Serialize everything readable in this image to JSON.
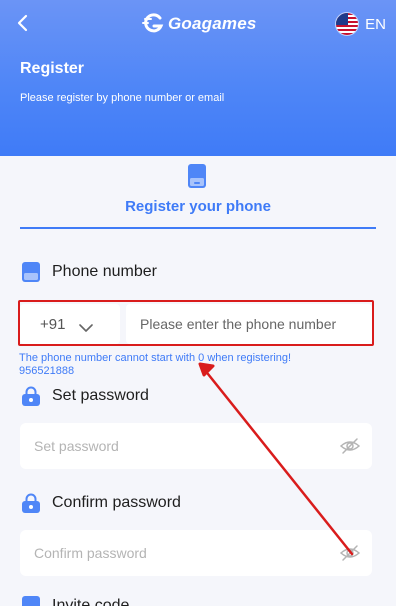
{
  "topbar": {
    "back_icon": "chevron-left-icon",
    "logo_text": "Goagames",
    "language_label": "EN",
    "flag_icon": "us-flag-icon"
  },
  "header": {
    "title": "Register",
    "subtitle": "Please register by phone number or email"
  },
  "tab": {
    "label": "Register your phone",
    "icon": "phone-icon"
  },
  "phone": {
    "label": "Phone number",
    "country_code": "+91",
    "placeholder": "Please enter the phone number",
    "warning": "The phone number cannot start with 0 when registering!",
    "example_number": "956521888"
  },
  "set_password": {
    "label": "Set password",
    "placeholder": "Set password"
  },
  "confirm_password": {
    "label": "Confirm password",
    "placeholder": "Confirm password"
  },
  "invite": {
    "label": "Invite code"
  },
  "colors": {
    "accent": "#3f7bf7",
    "header_top": "#6b94f6",
    "annotation": "#d91c1c",
    "background": "#f5f6fb"
  }
}
